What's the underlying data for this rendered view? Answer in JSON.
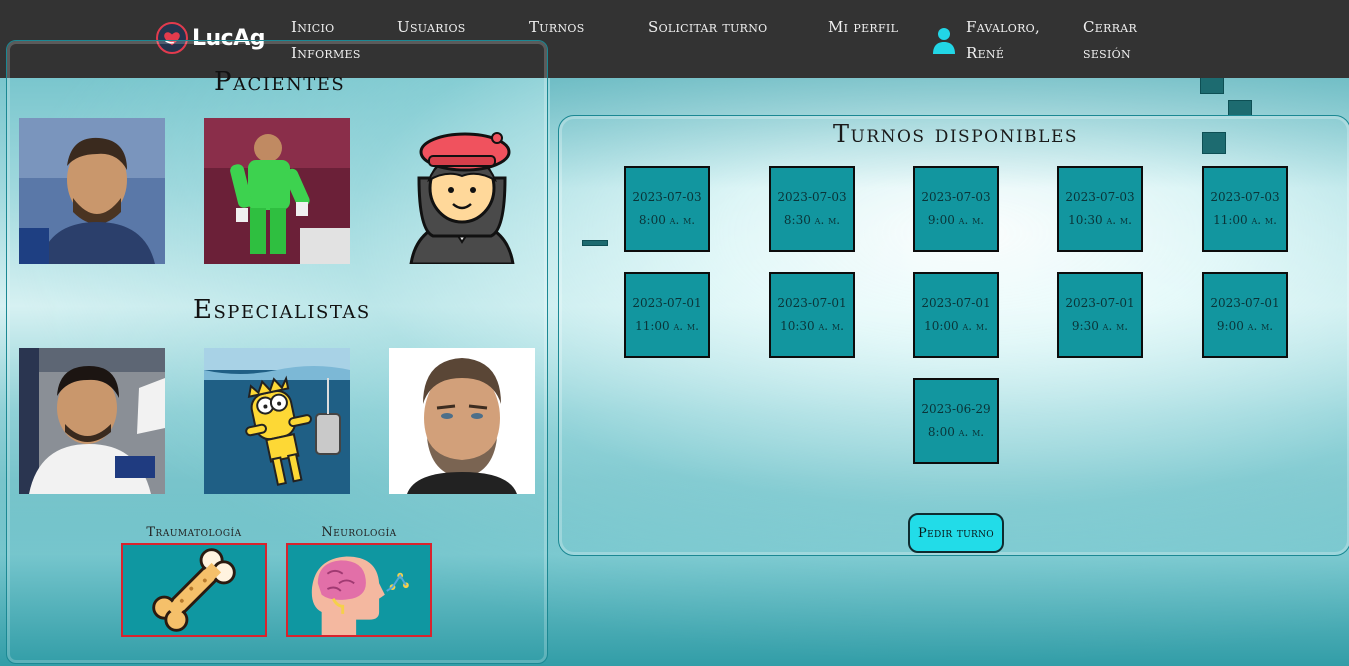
{
  "brand": {
    "name": "LucAg",
    "logo_icon": "heart-hand-icon"
  },
  "nav": {
    "inicio": "Inicio",
    "informes": "Informes",
    "usuarios": "Usuarios",
    "turnos": "Turnos",
    "solicitar": "Solicitar turno",
    "perfil": "Mi perfil",
    "user_line1": "Favaloro,",
    "user_line2": "René",
    "cerrar_line1": "Cerrar",
    "cerrar_line2": "sesión",
    "user_icon": "user-icon"
  },
  "pacientes": {
    "title": "Pacientes",
    "items": [
      {
        "image": "patient-photo-messi"
      },
      {
        "image": "patient-photo-goalkeeper"
      },
      {
        "image": "patient-avatar-illustration"
      }
    ]
  },
  "especialistas": {
    "title": "Especialistas",
    "items": [
      {
        "image": "specialist-photo-player"
      },
      {
        "image": "specialist-image-bart"
      },
      {
        "image": "specialist-photo-house"
      }
    ]
  },
  "especialidades": [
    {
      "label": "Traumatología",
      "icon": "bone-icon"
    },
    {
      "label": "Neurología",
      "icon": "brain-icon"
    }
  ],
  "turnos": {
    "title": "Turnos disponibles",
    "slots": [
      {
        "date": "2023-07-03",
        "time": "8:00 a. m."
      },
      {
        "date": "2023-07-03",
        "time": "8:30 a. m."
      },
      {
        "date": "2023-07-03",
        "time": "9:00 a. m."
      },
      {
        "date": "2023-07-03",
        "time": "10:30 a. m."
      },
      {
        "date": "2023-07-03",
        "time": "11:00 a. m."
      },
      {
        "date": "2023-07-01",
        "time": "11:00 a. m."
      },
      {
        "date": "2023-07-01",
        "time": "10:30 a. m."
      },
      {
        "date": "2023-07-01",
        "time": "10:00 a. m."
      },
      {
        "date": "2023-07-01",
        "time": "9:30 a. m."
      },
      {
        "date": "2023-07-01",
        "time": "9:00 a. m."
      },
      {
        "date": "2023-06-29",
        "time": "8:00 a. m."
      }
    ],
    "button": "Pedir turno"
  },
  "colors": {
    "navbar": "#333333",
    "slot": "#12969f",
    "button": "#22dce8",
    "card_border": "#d9232d"
  }
}
